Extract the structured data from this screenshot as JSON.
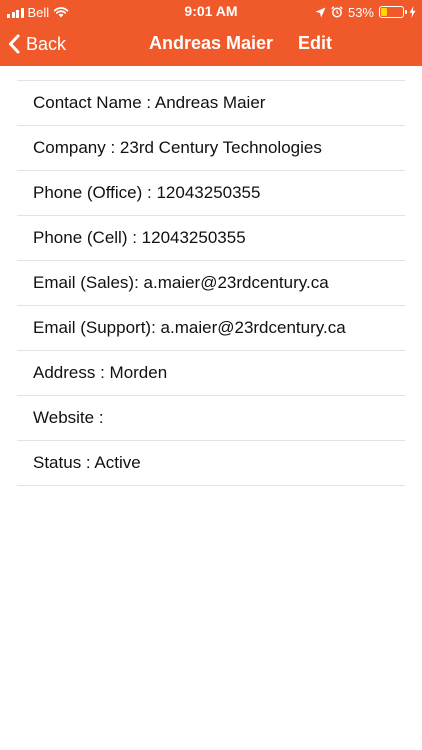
{
  "status_bar": {
    "carrier": "Bell",
    "time": "9:01 AM",
    "battery_percent": "53%",
    "battery_level": 0.53,
    "icons": [
      "signal-icon",
      "wifi-icon",
      "location-icon",
      "alarm-icon",
      "battery-icon",
      "charging-icon"
    ]
  },
  "nav": {
    "back_label": "Back",
    "title": "Andreas Maier",
    "edit_label": "Edit"
  },
  "colors": {
    "header": "#f0592a",
    "battery_fill": "#ffd500",
    "divider": "#e2e2e2"
  },
  "details": [
    "Contact Name : Andreas Maier",
    "Company : 23rd Century Technologies",
    "Phone (Office) : 12043250355",
    "Phone (Cell) : 12043250355",
    "Email (Sales): a.maier@23rdcentury.ca",
    "Email (Support): a.maier@23rdcentury.ca",
    "Address : Morden",
    "Website :",
    "Status : Active"
  ]
}
